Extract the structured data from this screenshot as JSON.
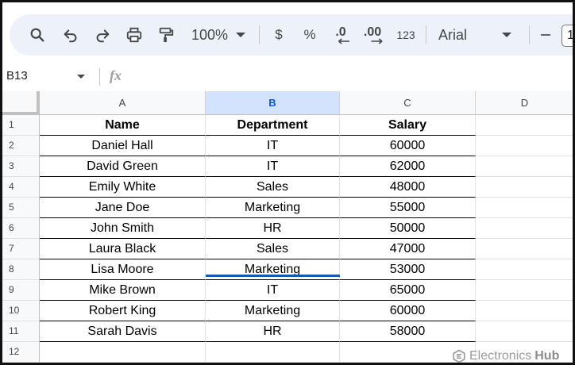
{
  "toolbar": {
    "zoom": "100%",
    "currency": "$",
    "percent": "%",
    "dec_decrease": ".0",
    "dec_increase": ".00",
    "number_format": "123",
    "font": "Arial",
    "font_size": "1"
  },
  "formula_bar": {
    "cell_ref": "B13",
    "fx": "fx"
  },
  "columns": [
    "A",
    "B",
    "C",
    "D"
  ],
  "rows": [
    "1",
    "2",
    "3",
    "4",
    "5",
    "6",
    "7",
    "8",
    "9",
    "10",
    "11",
    "12"
  ],
  "table": {
    "headers": [
      "Name",
      "Department",
      "Salary"
    ],
    "records": [
      [
        "Daniel Hall",
        "IT",
        "60000"
      ],
      [
        "David Green",
        "IT",
        "62000"
      ],
      [
        "Emily White",
        "Sales",
        "48000"
      ],
      [
        "Jane Doe",
        "Marketing",
        "55000"
      ],
      [
        "John Smith",
        "HR",
        "50000"
      ],
      [
        "Laura Black",
        "Sales",
        "47000"
      ],
      [
        "Lisa Moore",
        "Marketing",
        "53000"
      ],
      [
        "Mike Brown",
        "IT",
        "65000"
      ],
      [
        "Robert King",
        "Marketing",
        "60000"
      ],
      [
        "Sarah Davis",
        "HR",
        "58000"
      ]
    ]
  },
  "watermark": {
    "brand": "Electronics",
    "brand_bold": "Hub"
  },
  "colors": {
    "toolbar_bg": "#edf2fa",
    "selected_column": "#d3e3fd",
    "selection_indicator": "#1a57b8"
  }
}
